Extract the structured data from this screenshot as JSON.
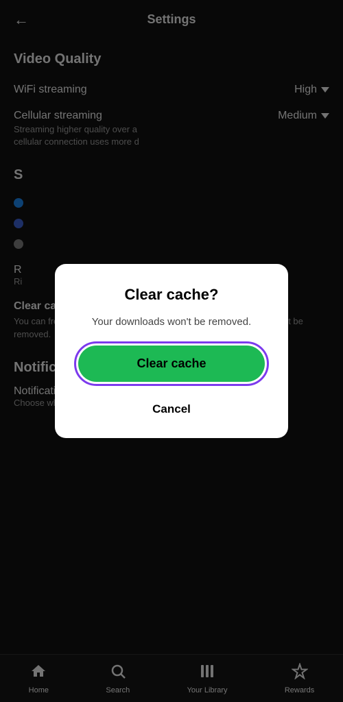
{
  "header": {
    "title": "Settings",
    "back_label": "←"
  },
  "sections": {
    "video_quality": {
      "title": "Video Quality",
      "wifi_label": "WiFi streaming",
      "wifi_value": "High",
      "cellular_label": "Cellular streaming",
      "cellular_desc": "Streaming higher quality over a cellular connection uses more d",
      "cellular_value": "Medium"
    },
    "storage": {
      "partial_title": "S",
      "items": [
        {
          "color": "blue",
          "label": ""
        },
        {
          "color": "blue2",
          "label": ""
        },
        {
          "color": "gray",
          "label": ""
        }
      ]
    },
    "r_section": {
      "title": "R",
      "desc": "Ri"
    },
    "clear_cache": {
      "title": "Clear cache",
      "desc": "You can free up storage by clearing your cache. Your downloads won't be removed."
    },
    "notifications": {
      "title": "Notifications",
      "item_title": "Notifications",
      "item_desc": "Choose which notifications to receive."
    }
  },
  "modal": {
    "title": "Clear cache?",
    "desc": "Your downloads won't be removed.",
    "clear_btn_label": "Clear cache",
    "cancel_btn_label": "Cancel"
  },
  "bottom_nav": {
    "items": [
      {
        "id": "home",
        "icon": "⌂",
        "label": "Home"
      },
      {
        "id": "search",
        "icon": "○",
        "label": "Search"
      },
      {
        "id": "library",
        "icon": "▐▌▌",
        "label": "Your Library"
      },
      {
        "id": "rewards",
        "icon": "◇",
        "label": "Rewards"
      }
    ]
  }
}
